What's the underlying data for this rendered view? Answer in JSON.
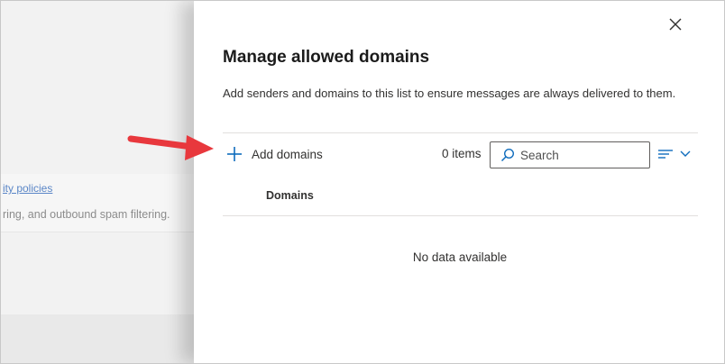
{
  "background": {
    "link_text": "ity policies",
    "text": "ring, and outbound spam filtering."
  },
  "panel": {
    "title": "Manage allowed domains",
    "description": "Add senders and domains to this list to ensure messages are always delivered to them.",
    "add_label": "Add domains",
    "item_count": "0 items",
    "search_placeholder": "Search",
    "column_header": "Domains",
    "empty_message": "No data available"
  },
  "icons": {
    "close": "close-icon",
    "add": "plus-icon",
    "search": "search-icon",
    "view": "filter-lines-icon",
    "chevron": "chevron-down-icon",
    "annotation": "red-arrow"
  },
  "colors": {
    "accent": "#0f6cbd",
    "annotation": "#e8383d",
    "link": "#5a86c7"
  }
}
